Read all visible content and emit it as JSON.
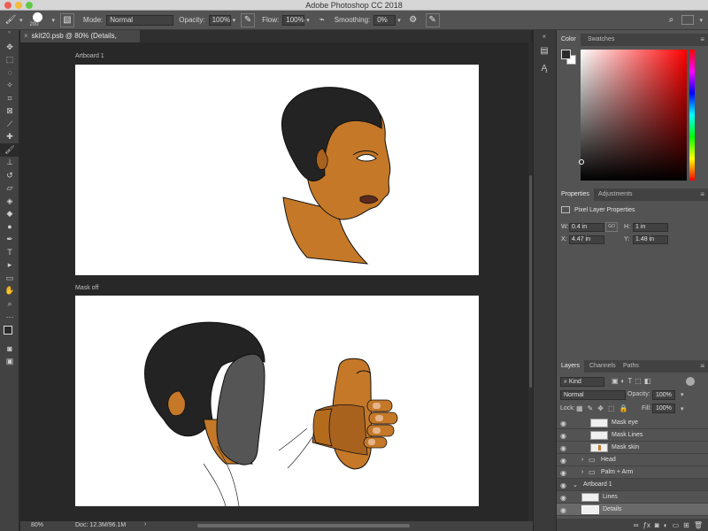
{
  "app": {
    "title": "Adobe Photoshop CC 2018"
  },
  "options": {
    "brush_size": "200",
    "mode_label": "Mode:",
    "mode_value": "Normal",
    "opacity_label": "Opacity:",
    "opacity_value": "100%",
    "flow_label": "Flow:",
    "flow_value": "100%",
    "smoothing_label": "Smoothing:",
    "smoothing_value": "0%"
  },
  "document": {
    "tab_title": "skit20.psb @ 80% (Details, RGB/8)",
    "artboards": [
      {
        "label": "Artboard 1"
      },
      {
        "label": "Mask off"
      }
    ]
  },
  "status": {
    "zoom": "80%",
    "doc_info": "Doc: 12.3M/96.1M"
  },
  "color_panel": {
    "tabs": [
      "Color",
      "Swatches"
    ]
  },
  "properties_panel": {
    "tabs": [
      "Properties",
      "Adjustments"
    ],
    "heading": "Pixel Layer Properties",
    "w_label": "W:",
    "w_value": "0.4 in",
    "h_label": "H:",
    "h_value": "1 in",
    "x_label": "X:",
    "x_value": "4.47 in",
    "y_label": "Y:",
    "y_value": "1.48 in",
    "link_label": "GO"
  },
  "layers_panel": {
    "tabs": [
      "Layers",
      "Channels",
      "Paths"
    ],
    "filter_label": "Kind",
    "blend_mode": "Normal",
    "opacity_label": "Opacity:",
    "opacity_value": "100%",
    "lock_label": "Lock:",
    "fill_label": "Fill:",
    "fill_value": "100%",
    "layers": [
      {
        "name": "Mask eye"
      },
      {
        "name": "Mask Lines"
      },
      {
        "name": "Mask skin"
      },
      {
        "name": "Head"
      },
      {
        "name": "Palm + Arm"
      },
      {
        "name": "Artboard 1"
      },
      {
        "name": "Lines"
      },
      {
        "name": "Details"
      }
    ]
  },
  "colors": {
    "skin": "#c47828",
    "hair": "#232323",
    "mask": "#555555",
    "lip": "#5a2a1e",
    "ui_panel": "#535353"
  }
}
